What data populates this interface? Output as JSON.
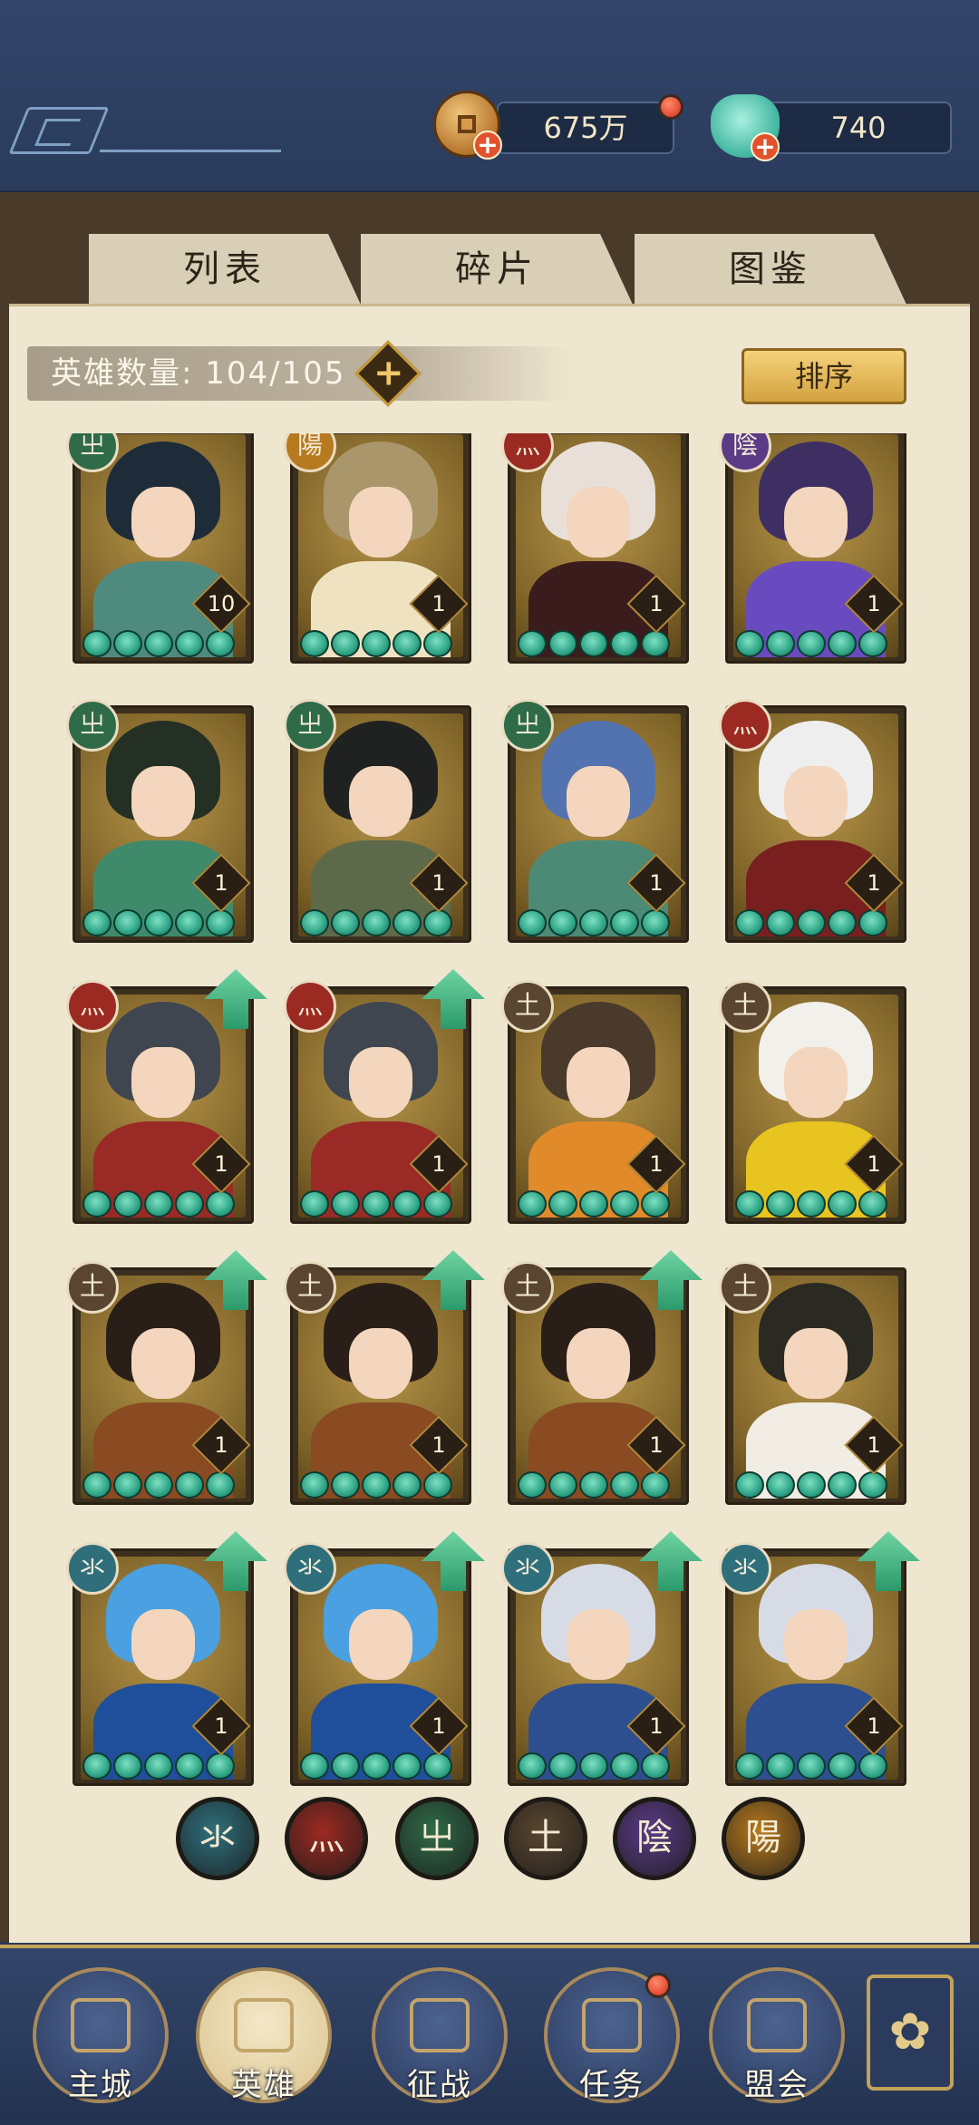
{
  "resources": {
    "coins": "675万",
    "jade": "740"
  },
  "tabs": [
    {
      "label": "列表",
      "active": true
    },
    {
      "label": "碎片",
      "active": false
    },
    {
      "label": "图鉴",
      "active": false
    }
  ],
  "hero_count_text": "英雄数量: 104/105",
  "sort_label": "排序",
  "elements": {
    "water": {
      "glyph": "氺",
      "color": "#2f6f7c"
    },
    "fire": {
      "glyph": "灬",
      "color": "#9b2a22"
    },
    "wind": {
      "glyph": "㞢",
      "color": "#2f6b48"
    },
    "earth": {
      "glyph": "土",
      "color": "#5a4630"
    },
    "yin": {
      "glyph": "陰",
      "color": "#5b3b85"
    },
    "yang": {
      "glyph": "陽",
      "color": "#b77a1e"
    }
  },
  "heroes": [
    {
      "element": "wind",
      "level": "10",
      "upgrade": false,
      "hair": "#1e2c3a",
      "outfit": "#4f8a7e"
    },
    {
      "element": "yang",
      "level": "1",
      "upgrade": false,
      "hair": "#a9966a",
      "outfit": "#efe2c0"
    },
    {
      "element": "fire",
      "level": "1",
      "upgrade": false,
      "hair": "#e8e0d8",
      "outfit": "#3a1c1c"
    },
    {
      "element": "yin",
      "level": "1",
      "upgrade": false,
      "hair": "#3e2f63",
      "outfit": "#6a4bbf"
    },
    {
      "element": "wind",
      "level": "1",
      "upgrade": false,
      "hair": "#243024",
      "outfit": "#3f8a6a"
    },
    {
      "element": "wind",
      "level": "1",
      "upgrade": false,
      "hair": "#1f2220",
      "outfit": "#5d6a4a"
    },
    {
      "element": "wind",
      "level": "1",
      "upgrade": false,
      "hair": "#5272b0",
      "outfit": "#4c8a76"
    },
    {
      "element": "fire",
      "level": "1",
      "upgrade": false,
      "hair": "#eeeeee",
      "outfit": "#7a1f1f"
    },
    {
      "element": "fire",
      "level": "1",
      "upgrade": true,
      "hair": "#40464f",
      "outfit": "#9a2a25"
    },
    {
      "element": "fire",
      "level": "1",
      "upgrade": true,
      "hair": "#40464f",
      "outfit": "#9a2a25"
    },
    {
      "element": "earth",
      "level": "1",
      "upgrade": false,
      "hair": "#4a3a2c",
      "outfit": "#e08a2a"
    },
    {
      "element": "earth",
      "level": "1",
      "upgrade": false,
      "hair": "#f2f0ea",
      "outfit": "#e8c420"
    },
    {
      "element": "earth",
      "level": "1",
      "upgrade": true,
      "hair": "#2a1f18",
      "outfit": "#8a4a22"
    },
    {
      "element": "earth",
      "level": "1",
      "upgrade": true,
      "hair": "#2a1f18",
      "outfit": "#8a4a22"
    },
    {
      "element": "earth",
      "level": "1",
      "upgrade": true,
      "hair": "#2a1f18",
      "outfit": "#8a4a22"
    },
    {
      "element": "earth",
      "level": "1",
      "upgrade": false,
      "hair": "#2b2a22",
      "outfit": "#f2ede4"
    },
    {
      "element": "water",
      "level": "1",
      "upgrade": true,
      "hair": "#4aa0e0",
      "outfit": "#1f4f9a"
    },
    {
      "element": "water",
      "level": "1",
      "upgrade": true,
      "hair": "#4aa0e0",
      "outfit": "#1f4f9a"
    },
    {
      "element": "water",
      "level": "1",
      "upgrade": true,
      "hair": "#d6dbe6",
      "outfit": "#2d4f8f"
    },
    {
      "element": "water",
      "level": "1",
      "upgrade": true,
      "hair": "#d6dbe6",
      "outfit": "#2d4f8f"
    }
  ],
  "filters": [
    "water",
    "fire",
    "wind",
    "earth",
    "yin",
    "yang"
  ],
  "nav": [
    {
      "label": "主城",
      "icon": "palace-icon",
      "badge": false
    },
    {
      "label": "英雄",
      "icon": "hero-portrait-icon",
      "badge": false,
      "active": true
    },
    {
      "label": "征战",
      "icon": "helmet-icon",
      "badge": false
    },
    {
      "label": "任务",
      "icon": "scroll-icon",
      "badge": true
    },
    {
      "label": "盟会",
      "icon": "pavilion-icon",
      "badge": false
    }
  ],
  "more_icon": "lattice-icon"
}
